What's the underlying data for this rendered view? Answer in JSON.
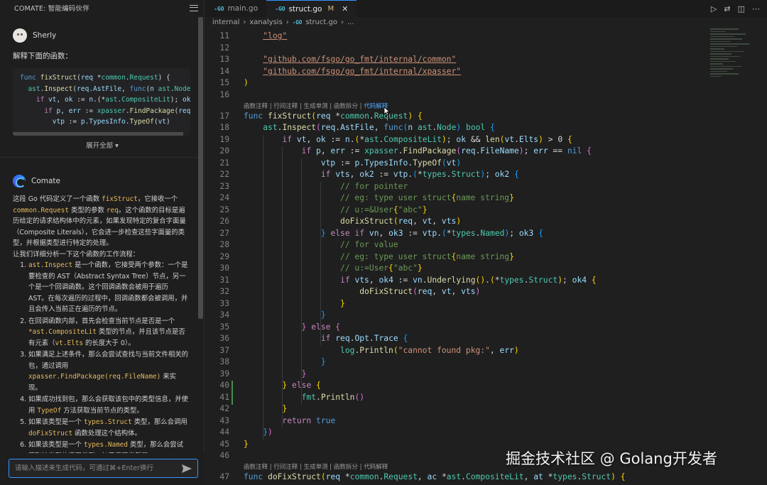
{
  "sidebar": {
    "title": "COMATE: 智能编码伙伴",
    "user": {
      "name": "Sherly",
      "question": "解释下面的函数："
    },
    "code_preview": [
      "func fixStruct(req *common.Request) {",
      "  ast.Inspect(req.AstFile, func(n ast.Node",
      "    if vt, ok := n.(*ast.CompositeLit); ok",
      "      if p, err := xpasser.FindPackage(req",
      "        vtp := p.TypesInfo.TypeOf(vt)"
    ],
    "expand_label": "展开全部 ▾",
    "bot": {
      "name": "Comate"
    },
    "answer_intro_1": "这段 Go 代码定义了一个函数 ",
    "answer_intro_fn": "fixStruct",
    "answer_intro_2": "，它接收一个 ",
    "answer_intro_type": "common.Request",
    "answer_intro_3": " 类型的参数 ",
    "answer_intro_param": "req",
    "answer_intro_4": "。这个函数的目标是遍历给定的请求结构体中的元素，如果发现特定的复合字面量（Composite Literals），它会进一步检查这些字面量的类型，并根据类型进行特定的处理。",
    "answer_lead": "让我们详细分析一下这个函数的工作流程：",
    "steps": [
      {
        "code": "ast.Inspect",
        "text": " 是一个函数，它接受两个参数：一个是要检查的 AST（Abstract Syntax Tree）节点，另一个是一个回调函数。这个回调函数会被用于遍历 AST。在每次遍历的过程中，回调函数都会被调用，并且会传入当前正在遍历的节点。"
      },
      {
        "pre": "在回调函数内部，首先会检查当前节点是否是一个 ",
        "code": "*ast.CompositeLit",
        "text": " 类型的节点，并且该节点是否有元素（",
        "code2": "vt.Elts",
        "text2": " 的长度大于 0）。"
      },
      {
        "pre": "如果满足上述条件，那么会尝试查找与当前文件相关的包，通过调用 ",
        "code": "xpasser.FindPackage(req.FileName)",
        "text": " 来实现。"
      },
      {
        "pre": "如果成功找到包，那么会获取该包中的类型信息，并使用 ",
        "code": "TypeOf",
        "text": " 方法获取当前节点的类型。"
      },
      {
        "pre": "如果该类型是一个 ",
        "code": "types.Struct",
        "text": " 类型，那么会调用 ",
        "code2": "doFixStruct",
        "text2": " 函数处理这个结构体。"
      },
      {
        "pre": "如果该类型是一个 ",
        "code": "types.Named",
        "text": " 类型，那么会尝试获取该类型的底层类型，如果底层类型是"
      }
    ],
    "input_placeholder": "请输入描述来生成代码，可通过⌘+Enter换行"
  },
  "tabs": [
    {
      "label": "main.go",
      "icon": "go-file-icon",
      "active": false,
      "modified": false
    },
    {
      "label": "struct.go",
      "icon": "go-file-icon",
      "active": true,
      "modified": true,
      "mod_marker": "M"
    }
  ],
  "breadcrumb": [
    "internal",
    "xanalysis",
    "struct.go",
    "..."
  ],
  "codelens": {
    "items": [
      "函数注释",
      "行间注释",
      "生成单测",
      "函数拆分",
      "代码解释"
    ],
    "sep": " | "
  },
  "editor": {
    "line_numbers": [
      11,
      12,
      13,
      14,
      15,
      16,
      17,
      18,
      19,
      20,
      21,
      22,
      23,
      24,
      25,
      26,
      27,
      28,
      29,
      30,
      31,
      32,
      33,
      34,
      35,
      36,
      37,
      38,
      39,
      40,
      41,
      42,
      43,
      44,
      45,
      46,
      47
    ],
    "accent_color": "#3794ff"
  },
  "watermark": "掘金技术社区 @ Golang开发者"
}
